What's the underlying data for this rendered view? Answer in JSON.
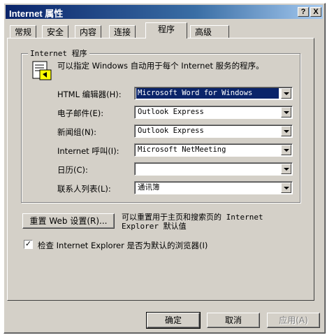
{
  "window": {
    "title": "Internet 属性",
    "help_btn": "?",
    "close_btn": "X"
  },
  "tabs": [
    {
      "label": "常规",
      "active": false
    },
    {
      "label": "安全",
      "active": false
    },
    {
      "label": "内容",
      "active": false
    },
    {
      "label": "连接",
      "active": false
    },
    {
      "label": "程序",
      "active": true
    },
    {
      "label": "高级",
      "active": false
    }
  ],
  "group": {
    "label": "Internet 程序",
    "intro": "可以指定 Windows 自动用于每个 Internet 服务的程序。",
    "rows": [
      {
        "label": "HTML 编辑器(H):",
        "value": "Microsoft Word for Windows",
        "selected": true
      },
      {
        "label": "电子邮件(E):",
        "value": "Outlook Express",
        "selected": false
      },
      {
        "label": "新闻组(N):",
        "value": "Outlook Express",
        "selected": false
      },
      {
        "label": "Internet 呼叫(I):",
        "value": "Microsoft NetMeeting",
        "selected": false
      },
      {
        "label": "日历(C):",
        "value": "",
        "selected": false
      },
      {
        "label": "联系人列表(L):",
        "value": "通讯簿",
        "selected": false
      }
    ]
  },
  "reset": {
    "button": "重置 Web 设置(R)...",
    "description_line1": "可以重置用于主页和搜索页的 Internet",
    "description_line2": "Explorer 默认值"
  },
  "check_default": {
    "label": "检查 Internet Explorer 是否为默认的浏览器(I)",
    "checked": true,
    "mark": "✓"
  },
  "buttons": {
    "ok": "确定",
    "cancel": "取消",
    "apply": "应用(A)"
  }
}
